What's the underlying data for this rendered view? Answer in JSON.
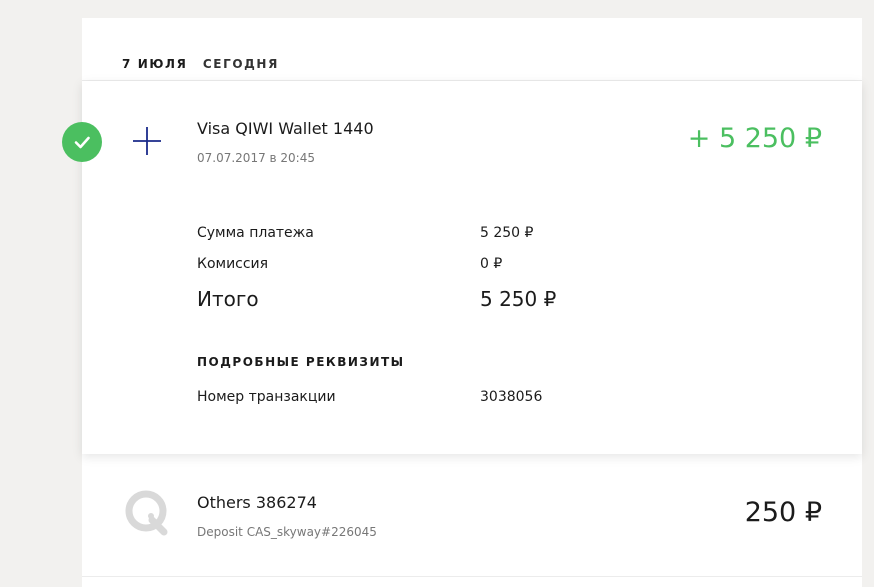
{
  "date_header": {
    "date": "7 июля",
    "label": "сегодня"
  },
  "transactions": [
    {
      "status_icon": "check-icon",
      "type_icon": "plus-icon",
      "title": "Visa QIWI Wallet 1440",
      "datetime": "07.07.2017 в 20:45",
      "amount": "+ 5 250 ₽",
      "amount_color": "#4bbf60",
      "details": {
        "payment_sum_label": "Сумма платежа",
        "payment_sum_value": "5 250 ₽",
        "commission_label": "Комиссия",
        "commission_value": "0 ₽",
        "total_label": "Итого",
        "total_value": "5 250 ₽",
        "requisites_title": "ПОДРОБНЫЕ РЕКВИЗИТЫ",
        "transaction_number_label": "Номер транзакции",
        "transaction_number_value": "3038056"
      }
    },
    {
      "type_icon": "qiwi-logo-icon",
      "title": "Others 386274",
      "description": "Deposit CAS_skyway#226045",
      "amount": "250 ₽"
    }
  ],
  "colors": {
    "success": "#4bbf60",
    "plus_icon": "#1a2a8a",
    "logo_gray": "#d9d9d9",
    "background": "#f2f1ef"
  }
}
